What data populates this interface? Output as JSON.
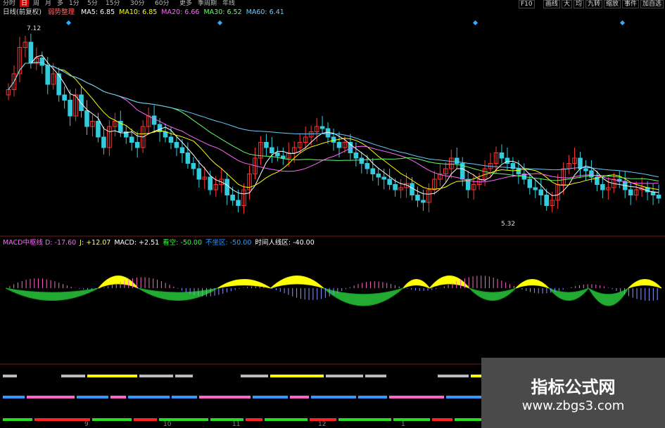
{
  "toolbar": {
    "left_items": [
      "分时",
      "日",
      "周",
      "月",
      "多",
      "1分",
      "5分",
      "15分",
      "30分",
      "60分",
      "更多",
      "季周期",
      "年线"
    ],
    "active": "日",
    "right_items": [
      "F10",
      "画线",
      "大",
      "均",
      "九转",
      "缩放",
      "事件",
      "加自选"
    ]
  },
  "ma_legend": {
    "title": "日线(前复权)",
    "trend": "弱势整理",
    "items": [
      {
        "label": "MA5: 6.85",
        "color": "#ffffff"
      },
      {
        "label": "MA10: 6.85",
        "color": "#ffff00"
      },
      {
        "label": "MA20: 6.66",
        "color": "#ff66ff"
      },
      {
        "label": "MA30: 6.52",
        "color": "#66ff66"
      },
      {
        "label": "MA60: 6.41",
        "color": "#66ccff"
      }
    ]
  },
  "price_labels": {
    "high": "7.12",
    "low": "5.32"
  },
  "macd_legend": {
    "items": [
      {
        "label": "MACD中枢线 D: -17.60",
        "color": "#ff66ff"
      },
      {
        "label": "J: +12.07",
        "color": "#ffff66"
      },
      {
        "label": "MACD: +2.51",
        "color": "#ffffff"
      },
      {
        "label": "看空: -50.00",
        "color": "#33ff33"
      },
      {
        "label": "不坐区: -50.00",
        "color": "#3399ff"
      },
      {
        "label": "时间人线区: -40.00",
        "color": "#ffffff"
      }
    ]
  },
  "watermark": {
    "title": "指标公式网",
    "url": "www.zbgs3.com"
  },
  "x_axis_labels": [
    "9",
    "10",
    "11",
    "12",
    "1"
  ],
  "chart_data": {
    "type": "candlestick",
    "high": 7.12,
    "low": 5.32,
    "closes": [
      6.55,
      6.7,
      6.95,
      7.0,
      6.8,
      6.85,
      6.78,
      6.6,
      6.7,
      6.5,
      6.45,
      6.3,
      6.5,
      6.35,
      6.2,
      6.25,
      6.1,
      6.0,
      6.2,
      6.25,
      6.15,
      6.1,
      6.05,
      6.0,
      6.2,
      6.3,
      6.22,
      6.15,
      6.1,
      6.05,
      6.0,
      5.95,
      5.85,
      5.8,
      5.7,
      5.72,
      5.6,
      5.65,
      5.7,
      5.55,
      5.5,
      5.45,
      5.6,
      5.75,
      5.9,
      6.05,
      6.0,
      5.95,
      5.92,
      5.9,
      5.95,
      6.0,
      6.05,
      6.1,
      6.15,
      6.2,
      6.18,
      6.1,
      6.05,
      6.0,
      6.05,
      5.95,
      5.9,
      5.85,
      5.8,
      5.75,
      5.72,
      5.7,
      5.65,
      5.6,
      5.62,
      5.66,
      5.55,
      5.5,
      5.48,
      5.6,
      5.7,
      5.75,
      5.8,
      5.9,
      5.85,
      5.7,
      5.6,
      5.65,
      5.7,
      5.8,
      5.85,
      5.95,
      5.9,
      5.85,
      5.8,
      5.75,
      5.7,
      5.62,
      5.6,
      5.55,
      5.45,
      5.5,
      5.65,
      5.8,
      5.85,
      5.9,
      5.8,
      5.78,
      5.72,
      5.65,
      5.6,
      5.62,
      5.7,
      5.68,
      5.6,
      5.55,
      5.6,
      5.62,
      5.58,
      5.55,
      5.52
    ],
    "macd_bands": [
      {
        "from": 0,
        "to": 14,
        "polarity": "neg"
      },
      {
        "from": 14,
        "to": 20,
        "polarity": "pos"
      },
      {
        "from": 20,
        "to": 32,
        "polarity": "neg"
      },
      {
        "from": 32,
        "to": 40,
        "polarity": "pos"
      },
      {
        "from": 40,
        "to": 48,
        "polarity": "pos"
      },
      {
        "from": 48,
        "to": 60,
        "polarity": "neg"
      },
      {
        "from": 60,
        "to": 64,
        "polarity": "pos"
      },
      {
        "from": 64,
        "to": 70,
        "polarity": "pos"
      },
      {
        "from": 70,
        "to": 77,
        "polarity": "neg"
      },
      {
        "from": 77,
        "to": 82,
        "polarity": "pos"
      },
      {
        "from": 82,
        "to": 88,
        "polarity": "neg"
      },
      {
        "from": 88,
        "to": 94,
        "polarity": "neg"
      },
      {
        "from": 94,
        "to": 99,
        "polarity": "pos"
      }
    ]
  }
}
